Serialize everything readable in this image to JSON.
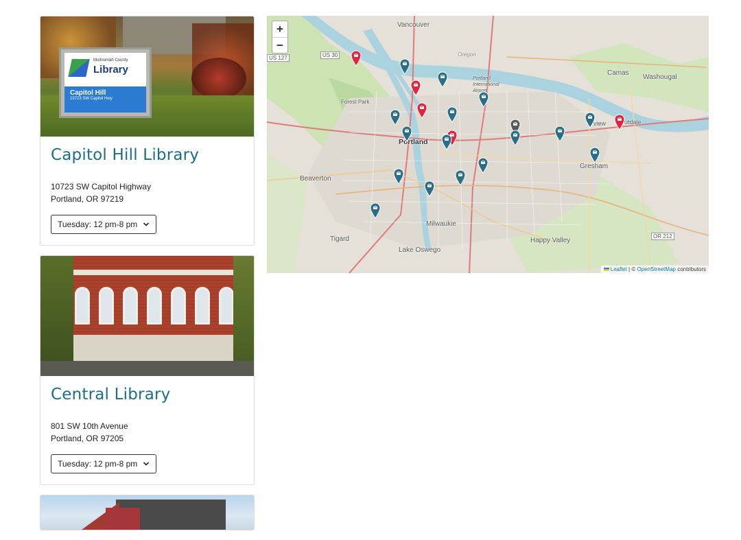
{
  "libraries": [
    {
      "name": "Capitol Hill Library",
      "address_line1": "10723 SW Capitol Highway",
      "address_line2": "Portland, OR 97219",
      "hours": "Tuesday: 12 pm-8 pm",
      "photo_sign": {
        "county": "Multnomah County",
        "word": "Library",
        "branch": "Capitol Hill",
        "street": "10723 SW Capitol Hwy"
      }
    },
    {
      "name": "Central Library",
      "address_line1": "801 SW 10th Avenue",
      "address_line2": "Portland, OR 97205",
      "hours": "Tuesday: 12 pm-8 pm"
    }
  ],
  "map": {
    "zoom_in": "+",
    "zoom_out": "−",
    "attribution": {
      "leaflet": "Leaflet",
      "sep": "| ©",
      "osm": "OpenStreetMap",
      "suffix": "contributors"
    },
    "place_labels": {
      "vancouver": "Vancouver",
      "portland": "Portland",
      "beaverton": "Beaverton",
      "gresham": "Gresham",
      "milwaukie": "Milwaukie",
      "tigard": "Tigard",
      "lake_oswego": "Lake Oswego",
      "happy_valley": "Happy Valley",
      "camas": "Camas",
      "washougal": "Washougal",
      "forest_park": "Forest Park",
      "airport": "Portland International Airport",
      "oregon": "Oregon",
      "fairview": "view",
      "troutdale": "utdale",
      "us30": "US 30",
      "us127": "US 127",
      "or212": "OR 212"
    },
    "marker_colors": {
      "blue": "#2a6f8a",
      "red": "#e4233f",
      "gray": "#5a5a5a"
    }
  }
}
